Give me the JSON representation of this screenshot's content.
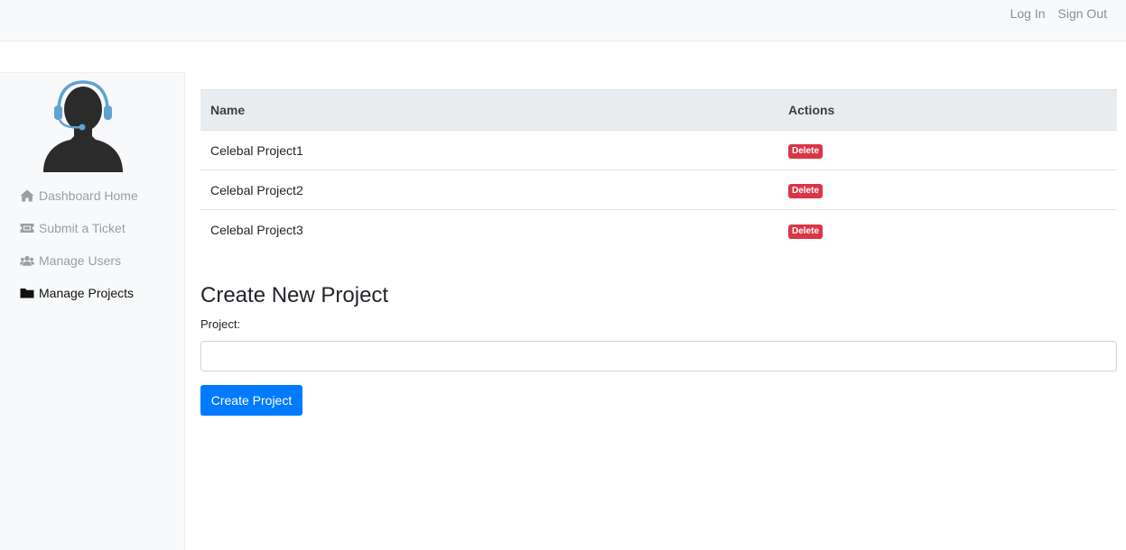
{
  "header": {
    "login_label": "Log In",
    "signout_label": "Sign Out"
  },
  "sidebar": {
    "items": [
      {
        "label": "Dashboard Home",
        "icon": "home-icon"
      },
      {
        "label": "Submit a Ticket",
        "icon": "ticket-icon"
      },
      {
        "label": "Manage Users",
        "icon": "users-icon"
      },
      {
        "label": "Manage Projects",
        "icon": "folder-icon",
        "active": true
      }
    ]
  },
  "table": {
    "headers": {
      "name": "Name",
      "actions": "Actions"
    },
    "rows": [
      {
        "name": "Celebal Project1",
        "action": "Delete"
      },
      {
        "name": "Celebal Project2",
        "action": "Delete"
      },
      {
        "name": "Celebal Project3",
        "action": "Delete"
      }
    ]
  },
  "form": {
    "title": "Create New Project",
    "label": "Project:",
    "value": "",
    "placeholder": "",
    "submit_label": "Create Project"
  },
  "colors": {
    "primary": "#007bff",
    "danger": "#dc3545",
    "avatar_headset": "#5fa3d0",
    "avatar_body": "#2b2b2b"
  }
}
